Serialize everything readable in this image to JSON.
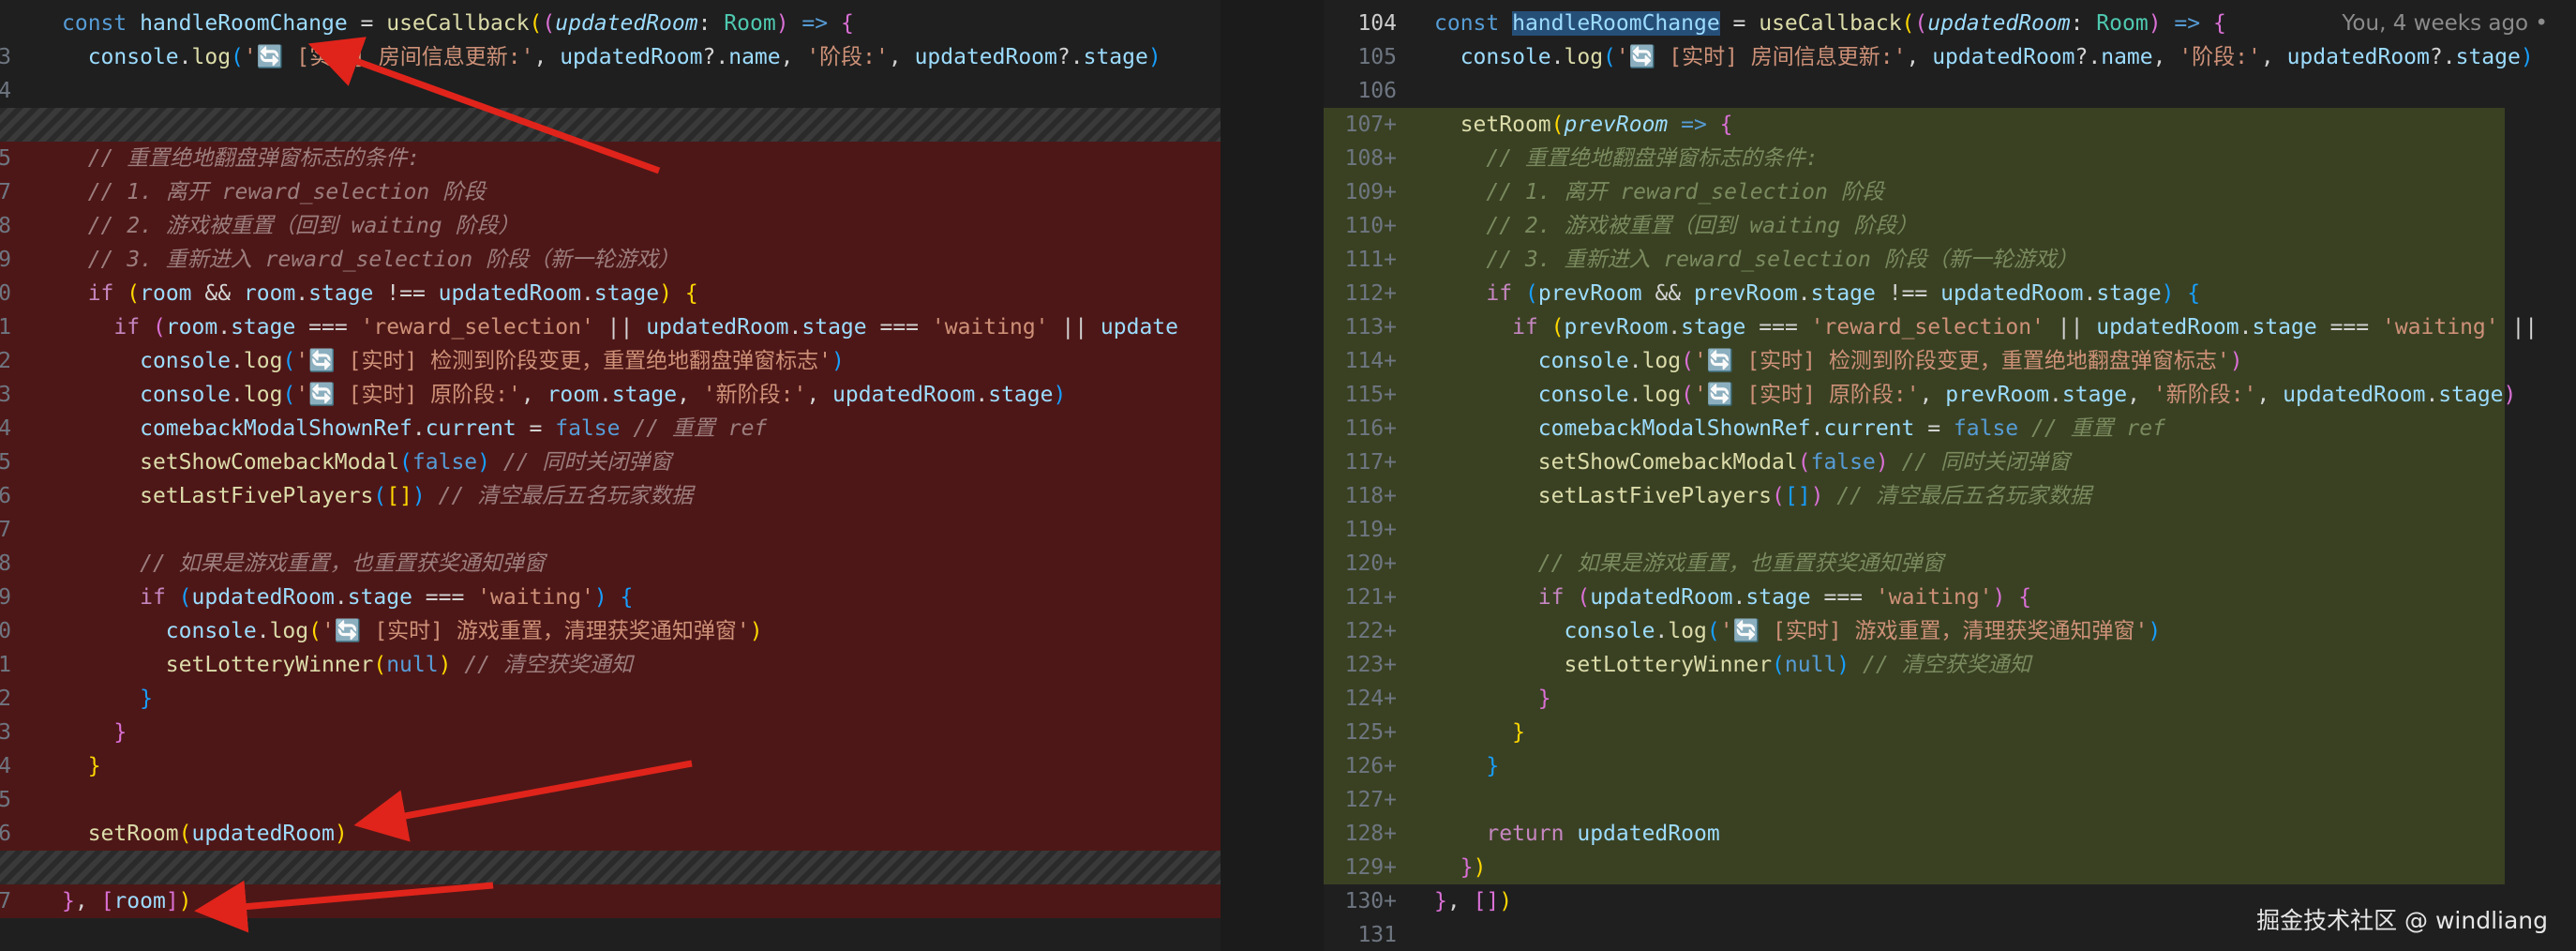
{
  "left": {
    "rows": [
      {
        "n": "3",
        "type": "ctx"
      },
      {
        "n": "4",
        "type": "ctx"
      },
      {
        "n": "",
        "type": "blank"
      },
      {
        "n": "",
        "type": "hatch"
      },
      {
        "n": "5",
        "type": "del"
      },
      {
        "n": "7",
        "type": "del"
      },
      {
        "n": "8",
        "type": "del"
      },
      {
        "n": "9",
        "type": "del"
      },
      {
        "n": "0",
        "type": "del"
      },
      {
        "n": "1",
        "type": "del"
      },
      {
        "n": "2",
        "type": "del"
      },
      {
        "n": "3",
        "type": "del"
      },
      {
        "n": "4",
        "type": "del"
      },
      {
        "n": "5",
        "type": "del"
      },
      {
        "n": "6",
        "type": "del"
      },
      {
        "n": "7",
        "type": "del"
      },
      {
        "n": "8",
        "type": "del"
      },
      {
        "n": "9",
        "type": "del"
      },
      {
        "n": "0",
        "type": "del"
      },
      {
        "n": "1",
        "type": "del"
      },
      {
        "n": "2",
        "type": "del"
      },
      {
        "n": "3",
        "type": "del"
      },
      {
        "n": "4",
        "type": "del"
      },
      {
        "n": "5",
        "type": "del"
      },
      {
        "n": "6",
        "type": "del"
      },
      {
        "n": "",
        "type": "hatch"
      },
      {
        "n": "7",
        "type": "del"
      }
    ]
  },
  "right": {
    "line_numbers": [
      "104",
      "105",
      "106",
      "107+",
      "108+",
      "109+",
      "110+",
      "111+",
      "112+",
      "113+",
      "114+",
      "115+",
      "116+",
      "117+",
      "118+",
      "119+",
      "120+",
      "121+",
      "122+",
      "123+",
      "124+",
      "125+",
      "126+",
      "127+",
      "128+",
      "129+",
      "130+",
      "131"
    ],
    "blame": "You, 4 weeks ago •"
  },
  "tokens": {
    "const": "const",
    "handleRoomChange": "handleRoomChange",
    "useCallback": "useCallback",
    "updatedRoom": "updatedRoom",
    "Room": "Room",
    "console": "console",
    "log": "log",
    "log_room_info": "'🔄 [实时] 房间信息更新:'",
    "name": "name",
    "stage_label": "'阶段:'",
    "stage": "stage",
    "setRoom": "setRoom",
    "prevRoom": "prevRoom",
    "c1": "// 重置绝地翻盘弹窗标志的条件:",
    "c2": "// 1. 离开 reward_selection 阶段",
    "c3": "// 2. 游戏被重置（回到 waiting 阶段）",
    "c4": "// 3. 重新进入 reward_selection 阶段（新一轮游戏）",
    "if": "if",
    "room": "room",
    "reward_selection": "'reward_selection'",
    "waiting": "'waiting'",
    "log_detect": "'🔄 [实时] 检测到阶段变更，重置绝地翻盘弹窗标志'",
    "log_old": "'🔄 [实时] 原阶段:'",
    "new_stage": "'新阶段:'",
    "comebackModalShownRef": "comebackModalShownRef",
    "current": "current",
    "false": "false",
    "c_reset_ref": "// 重置 ref",
    "setShowComebackModal": "setShowComebackModal",
    "c_close_modal": "// 同时关闭弹窗",
    "setLastFivePlayers": "setLastFivePlayers",
    "c_clear_players": "// 清空最后五名玩家数据",
    "c_game_reset": "// 如果是游戏重置，也重置获奖通知弹窗",
    "log_reset": "'🔄 [实时] 游戏重置，清理获奖通知弹窗'",
    "setLotteryWinner": "setLotteryWinner",
    "null": "null",
    "c_clear_winner": "// 清空获奖通知",
    "return": "return",
    "update": "update"
  },
  "watermark": "掘金技术社区 @ windliang",
  "colors": {
    "deleted": "#4e1717",
    "inserted": "#3a4123",
    "arrow": "#e0241b"
  }
}
